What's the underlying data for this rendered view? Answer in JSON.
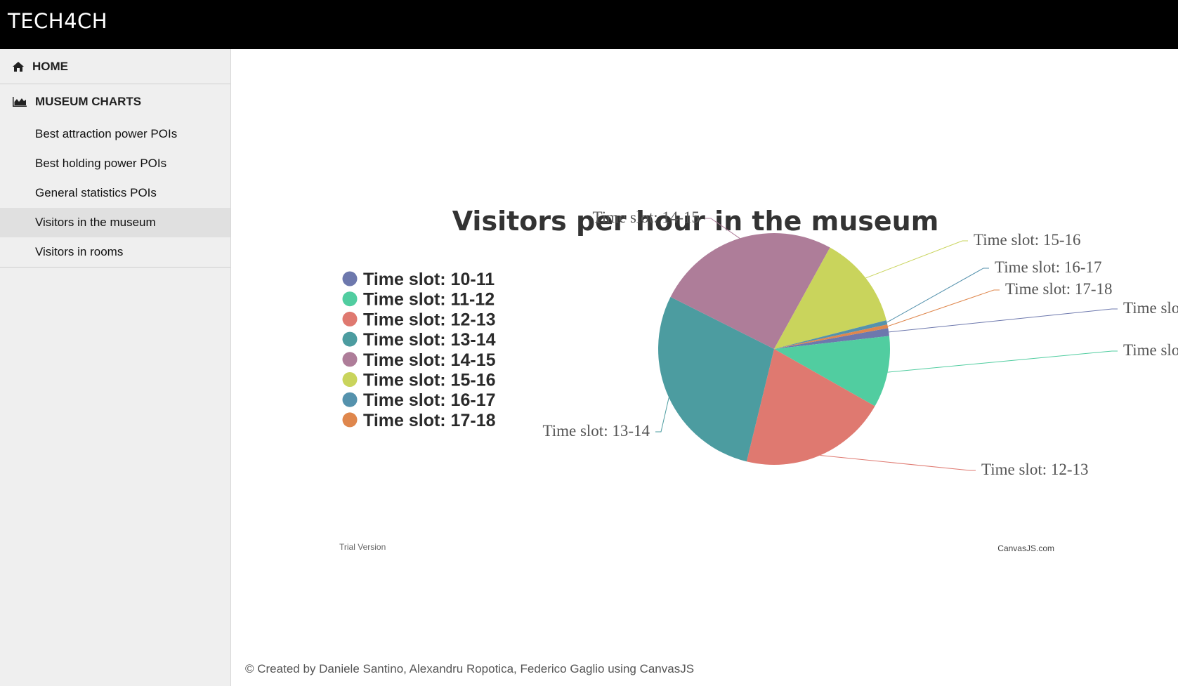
{
  "app": {
    "brand": "TECH4CH"
  },
  "sidebar": {
    "home_label": "HOME",
    "charts_label": "MUSEUM CHARTS",
    "items": [
      {
        "label": "Best attraction power POIs",
        "active": false
      },
      {
        "label": "Best holding power POIs",
        "active": false
      },
      {
        "label": "General statistics POIs",
        "active": false
      },
      {
        "label": "Visitors in the museum",
        "active": true
      },
      {
        "label": "Visitors in rooms",
        "active": false
      }
    ]
  },
  "chart": {
    "trial_text": "Trial Version",
    "credit_text": "CanvasJS.com"
  },
  "chart_data": {
    "type": "pie",
    "title": "Visitors per hour in the museum",
    "legend_position": "left",
    "categories": [
      "Time slot: 10-11",
      "Time slot: 11-12",
      "Time slot: 12-13",
      "Time slot: 13-14",
      "Time slot: 14-15",
      "Time slot: 15-16",
      "Time slot: 16-17",
      "Time slot: 17-18"
    ],
    "values": [
      1.1,
      10.0,
      20.6,
      28.6,
      25.6,
      13.0,
      0.6,
      0.5
    ],
    "colors": [
      "#6D78AD",
      "#51CDA0",
      "#DF7970",
      "#4C9CA0",
      "#AE7D99",
      "#C9D45C",
      "#5592AD",
      "#DF874D"
    ]
  },
  "footer": {
    "text": "© Created by Daniele Santino, Alexandru Ropotica, Federico Gaglio using CanvasJS"
  }
}
